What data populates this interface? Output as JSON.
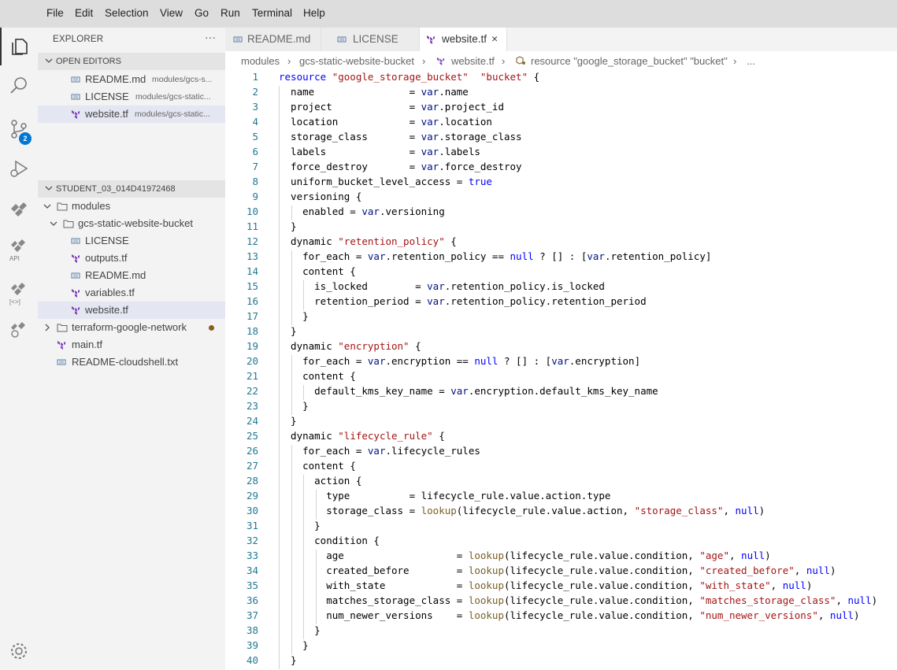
{
  "menu": [
    "File",
    "Edit",
    "Selection",
    "View",
    "Go",
    "Run",
    "Terminal",
    "Help"
  ],
  "activity": {
    "badge_count": "2",
    "api_label": "API",
    "bracket_label": "[<>]"
  },
  "sidebar": {
    "title": "EXPLORER",
    "more": "···",
    "open_editors_header": "OPEN EDITORS",
    "open_editors": [
      {
        "name": "README.md",
        "desc": "modules/gcs-s..."
      },
      {
        "name": "LICENSE",
        "desc": "modules/gcs-static..."
      },
      {
        "name": "website.tf",
        "desc": "modules/gcs-static..."
      }
    ],
    "workspace_header": "STUDENT_03_014D41972468",
    "tree": [
      {
        "name": "modules"
      },
      {
        "name": "gcs-static-website-bucket"
      },
      {
        "name": "LICENSE"
      },
      {
        "name": "outputs.tf"
      },
      {
        "name": "README.md"
      },
      {
        "name": "variables.tf"
      },
      {
        "name": "website.tf"
      },
      {
        "name": "terraform-google-network"
      },
      {
        "name": "main.tf"
      },
      {
        "name": "README-cloudshell.txt"
      }
    ]
  },
  "tabs": [
    {
      "label": "README.md"
    },
    {
      "label": "LICENSE"
    },
    {
      "label": "website.tf",
      "close": "×"
    }
  ],
  "breadcrumbs": {
    "parts": [
      "modules",
      "gcs-static-website-bucket",
      "website.tf",
      "resource \"google_storage_bucket\" \"bucket\"",
      "..."
    ],
    "sep": "›"
  },
  "editor": {
    "line_numbers": [
      "1",
      "2",
      "3",
      "4",
      "5",
      "6",
      "7",
      "8",
      "9",
      "10",
      "11",
      "12",
      "13",
      "14",
      "15",
      "16",
      "17",
      "18",
      "19",
      "20",
      "21",
      "22",
      "23",
      "24",
      "25",
      "26",
      "27",
      "28",
      "29",
      "30",
      "31",
      "32",
      "33",
      "34",
      "35",
      "36",
      "37",
      "38",
      "39",
      "40"
    ],
    "lines": [
      [
        [
          "k",
          "resource "
        ],
        [
          "s",
          "\"google_storage_bucket\""
        ],
        [
          "",
          "  "
        ],
        [
          "s",
          "\"bucket\""
        ],
        [
          "",
          " {"
        ]
      ],
      [
        [
          "",
          "  name                = "
        ],
        [
          "vr",
          "var"
        ],
        [
          "",
          ".name"
        ]
      ],
      [
        [
          "",
          "  project             = "
        ],
        [
          "vr",
          "var"
        ],
        [
          "",
          ".project_id"
        ]
      ],
      [
        [
          "",
          "  location            = "
        ],
        [
          "vr",
          "var"
        ],
        [
          "",
          ".location"
        ]
      ],
      [
        [
          "",
          "  storage_class       = "
        ],
        [
          "vr",
          "var"
        ],
        [
          "",
          ".storage_class"
        ]
      ],
      [
        [
          "",
          "  labels              = "
        ],
        [
          "vr",
          "var"
        ],
        [
          "",
          ".labels"
        ]
      ],
      [
        [
          "",
          "  force_destroy       = "
        ],
        [
          "vr",
          "var"
        ],
        [
          "",
          ".force_destroy"
        ]
      ],
      [
        [
          "",
          "  uniform_bucket_level_access = "
        ],
        [
          "k",
          "true"
        ]
      ],
      [
        [
          "",
          "  versioning {"
        ]
      ],
      [
        [
          "",
          "    enabled = "
        ],
        [
          "vr",
          "var"
        ],
        [
          "",
          ".versioning"
        ]
      ],
      [
        [
          "",
          "  }"
        ]
      ],
      [
        [
          "",
          "  dynamic "
        ],
        [
          "s",
          "\"retention_policy\""
        ],
        [
          "",
          " {"
        ]
      ],
      [
        [
          "",
          "    for_each = "
        ],
        [
          "vr",
          "var"
        ],
        [
          "",
          ".retention_policy == "
        ],
        [
          "k",
          "null"
        ],
        [
          "",
          " ? [] : ["
        ],
        [
          "vr",
          "var"
        ],
        [
          "",
          ".retention_policy]"
        ]
      ],
      [
        [
          "",
          "    content {"
        ]
      ],
      [
        [
          "",
          "      is_locked        = "
        ],
        [
          "vr",
          "var"
        ],
        [
          "",
          ".retention_policy.is_locked"
        ]
      ],
      [
        [
          "",
          "      retention_period = "
        ],
        [
          "vr",
          "var"
        ],
        [
          "",
          ".retention_policy.retention_period"
        ]
      ],
      [
        [
          "",
          "    }"
        ]
      ],
      [
        [
          "",
          "  }"
        ]
      ],
      [
        [
          "",
          "  dynamic "
        ],
        [
          "s",
          "\"encryption\""
        ],
        [
          "",
          " {"
        ]
      ],
      [
        [
          "",
          "    for_each = "
        ],
        [
          "vr",
          "var"
        ],
        [
          "",
          ".encryption == "
        ],
        [
          "k",
          "null"
        ],
        [
          "",
          " ? [] : ["
        ],
        [
          "vr",
          "var"
        ],
        [
          "",
          ".encryption]"
        ]
      ],
      [
        [
          "",
          "    content {"
        ]
      ],
      [
        [
          "",
          "      default_kms_key_name = "
        ],
        [
          "vr",
          "var"
        ],
        [
          "",
          ".encryption.default_kms_key_name"
        ]
      ],
      [
        [
          "",
          "    }"
        ]
      ],
      [
        [
          "",
          "  }"
        ]
      ],
      [
        [
          "",
          "  dynamic "
        ],
        [
          "s",
          "\"lifecycle_rule\""
        ],
        [
          "",
          " {"
        ]
      ],
      [
        [
          "",
          "    for_each = "
        ],
        [
          "vr",
          "var"
        ],
        [
          "",
          ".lifecycle_rules"
        ]
      ],
      [
        [
          "",
          "    content {"
        ]
      ],
      [
        [
          "",
          "      action {"
        ]
      ],
      [
        [
          "",
          "        type          = lifecycle_rule.value.action.type"
        ]
      ],
      [
        [
          "",
          "        storage_class = "
        ],
        [
          "f",
          "lookup"
        ],
        [
          "",
          "(lifecycle_rule.value.action, "
        ],
        [
          "s",
          "\"storage_class\""
        ],
        [
          "",
          ", "
        ],
        [
          "k",
          "null"
        ],
        [
          "",
          ")"
        ]
      ],
      [
        [
          "",
          "      }"
        ]
      ],
      [
        [
          "",
          "      condition {"
        ]
      ],
      [
        [
          "",
          "        age                   = "
        ],
        [
          "f",
          "lookup"
        ],
        [
          "",
          "(lifecycle_rule.value.condition, "
        ],
        [
          "s",
          "\"age\""
        ],
        [
          "",
          ", "
        ],
        [
          "k",
          "null"
        ],
        [
          "",
          ")"
        ]
      ],
      [
        [
          "",
          "        created_before        = "
        ],
        [
          "f",
          "lookup"
        ],
        [
          "",
          "(lifecycle_rule.value.condition, "
        ],
        [
          "s",
          "\"created_before\""
        ],
        [
          "",
          ", "
        ],
        [
          "k",
          "null"
        ],
        [
          "",
          ")"
        ]
      ],
      [
        [
          "",
          "        with_state            = "
        ],
        [
          "f",
          "lookup"
        ],
        [
          "",
          "(lifecycle_rule.value.condition, "
        ],
        [
          "s",
          "\"with_state\""
        ],
        [
          "",
          ", "
        ],
        [
          "k",
          "null"
        ],
        [
          "",
          ")"
        ]
      ],
      [
        [
          "",
          "        matches_storage_class = "
        ],
        [
          "f",
          "lookup"
        ],
        [
          "",
          "(lifecycle_rule.value.condition, "
        ],
        [
          "s",
          "\"matches_storage_class\""
        ],
        [
          "",
          ", "
        ],
        [
          "k",
          "null"
        ],
        [
          "",
          ")"
        ]
      ],
      [
        [
          "",
          "        num_newer_versions    = "
        ],
        [
          "f",
          "lookup"
        ],
        [
          "",
          "(lifecycle_rule.value.condition, "
        ],
        [
          "s",
          "\"num_newer_versions\""
        ],
        [
          "",
          ", "
        ],
        [
          "k",
          "null"
        ],
        [
          "",
          ")"
        ]
      ],
      [
        [
          "",
          "      }"
        ]
      ],
      [
        [
          "",
          "    }"
        ]
      ],
      [
        [
          "",
          "  }"
        ]
      ]
    ]
  }
}
